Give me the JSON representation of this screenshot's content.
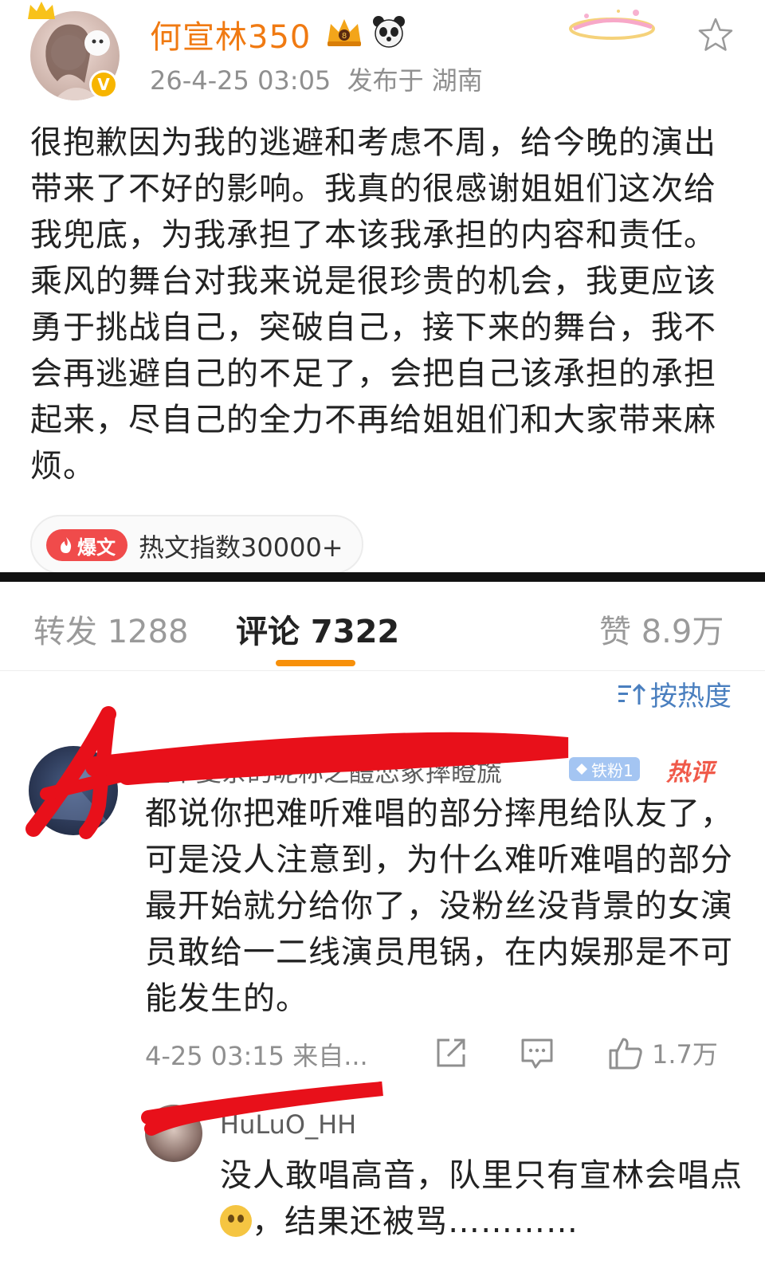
{
  "post": {
    "username": "何宣林350",
    "timestamp": "26-4-25 03:05",
    "location": "发布于 湖南",
    "text": "很抱歉因为我的逃避和考虑不周，给今晚的演出带来了不好的影响。我真的很感谢姐姐们这次给我兜底，为我承担了本该我承担的内容和责任。乘风的舞台对我来说是很珍贵的机会，我更应该勇于挑战自己，突破自己，接下来的舞台，我不会再逃避自己的不足了，会把自己该承担的承担起来，尽自己的全力不再给姐姐们和大家带来麻烦。",
    "hot_tag": "爆文",
    "hot_index": "热文指数30000+",
    "verified_badge": "V"
  },
  "tabs": {
    "repost": "转发 1288",
    "comments": "评论 7322",
    "likes": "赞 8.9万"
  },
  "sort_label": "按热度",
  "comment": {
    "author": "起个复杂的昵称之醴恋冢摔瞪旒",
    "fan_badge": "铁粉1",
    "hot_label": "热评",
    "text": "都说你把难听难唱的部分摔甩给队友了，可是没人注意到，为什么难听难唱的部分最开始就分给你了，没粉丝没背景的女演员敢给一二线演员甩锅，在内娱那是不可能发生的。",
    "time": "4-25 03:15",
    "source": "来自...",
    "like_count": "1.7万"
  },
  "reply": {
    "author": "HuLuO_HH",
    "text_before": "没人敢唱高音，队里只有宣林会唱点",
    "text_after": "，结果还被骂…………"
  },
  "icons": {
    "star": "star-icon",
    "share": "share-icon",
    "comment": "comment-icon",
    "like": "thumbs-up-icon",
    "sort": "sort-icon"
  },
  "colors": {
    "username": "#f07a12",
    "tab_underline": "#f7900a",
    "sort_link": "#4a7fbf",
    "hot_tag": "#f04b4b",
    "scribble": "#e8101a"
  }
}
